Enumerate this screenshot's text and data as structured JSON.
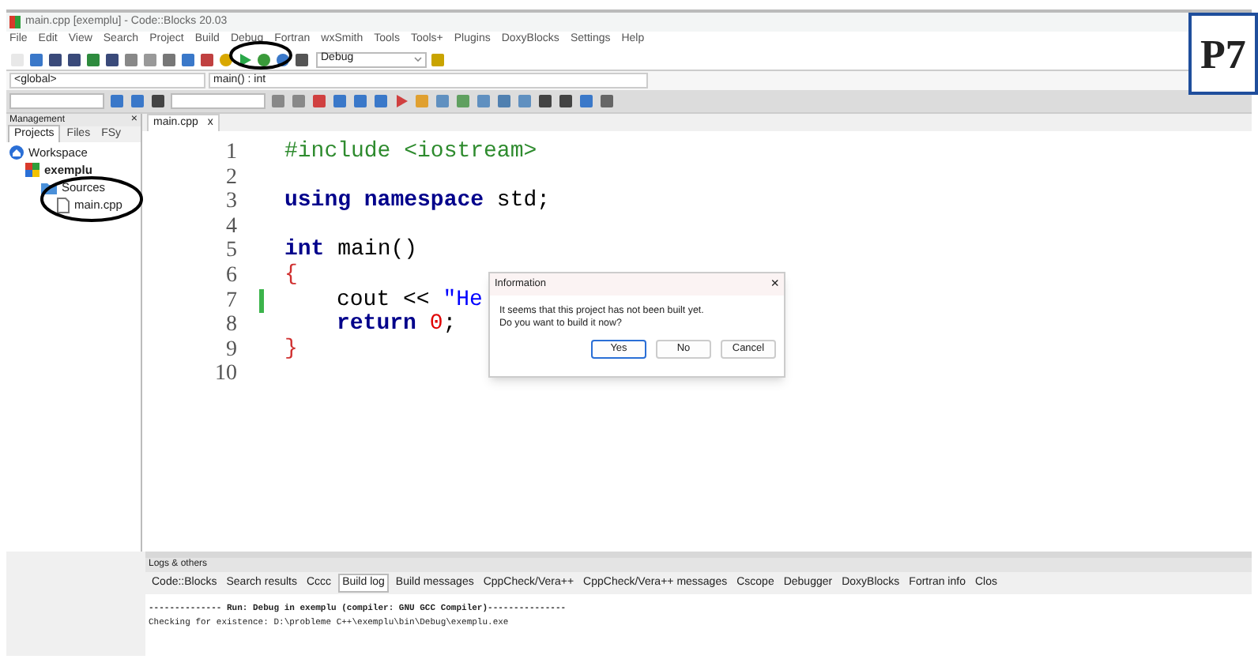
{
  "badge": "P7",
  "window": {
    "title": "main.cpp [exemplu] - Code::Blocks 20.03"
  },
  "menu": [
    "File",
    "Edit",
    "View",
    "Search",
    "Project",
    "Build",
    "Debug",
    "Fortran",
    "wxSmith",
    "Tools",
    "Tools+",
    "Plugins",
    "DoxyBlocks",
    "Settings",
    "Help"
  ],
  "build_target": "Debug",
  "scope_combo": "<global>",
  "function_combo": "main() : int",
  "management": {
    "title": "Management",
    "close": "×",
    "tabs": [
      {
        "label": "Projects",
        "selected": true
      },
      {
        "label": "Files",
        "selected": false
      },
      {
        "label": "FSy",
        "selected": false
      }
    ],
    "tree": [
      {
        "label": "Workspace",
        "kind": "workspace",
        "children": [
          {
            "label": "exemplu",
            "kind": "project",
            "children": [
              {
                "label": "Sources",
                "kind": "folder",
                "children": [
                  {
                    "label": "main.cpp",
                    "kind": "file"
                  }
                ]
              }
            ]
          }
        ]
      }
    ]
  },
  "editor": {
    "tab": "main.cpp",
    "tab_close": "x",
    "lines": [
      {
        "number": "1",
        "changed": false,
        "indented": false,
        "tokens": [
          {
            "kind": "preproc",
            "text": "#include <iostream>"
          }
        ]
      },
      {
        "number": "2",
        "changed": false
      },
      {
        "number": "3",
        "changed": false,
        "indented": false,
        "tokens": [
          {
            "kind": "keyword",
            "text": "using namespace "
          },
          {
            "kind": "plain",
            "text": "std;"
          }
        ]
      },
      {
        "number": "4",
        "changed": false
      },
      {
        "number": "5",
        "changed": false,
        "indented": false,
        "tokens": [
          {
            "kind": "keyword",
            "text": "int "
          },
          {
            "kind": "plain",
            "text": "main()"
          }
        ]
      },
      {
        "number": "6",
        "changed": false,
        "indented": false,
        "tokens": [
          {
            "kind": "brace",
            "text": "{"
          }
        ]
      },
      {
        "number": "7",
        "changed": true,
        "indented": true,
        "tokens": [
          {
            "kind": "plain",
            "text": "cout << "
          },
          {
            "kind": "string",
            "text": "\"He"
          }
        ]
      },
      {
        "number": "8",
        "changed": false,
        "indented": true,
        "tokens": [
          {
            "kind": "keyword",
            "text": "return "
          },
          {
            "kind": "number",
            "text": "0"
          },
          {
            "kind": "plain",
            "text": ";"
          }
        ]
      },
      {
        "number": "9",
        "changed": false,
        "indented": false,
        "tokens": [
          {
            "kind": "brace",
            "text": "}"
          }
        ]
      },
      {
        "number": "10",
        "changed": false
      }
    ]
  },
  "dialog": {
    "title": "Information",
    "close": "×",
    "message": [
      "It seems that this project has not been built yet.",
      "Do you want to build it now?"
    ],
    "buttons": [
      {
        "label": "Yes",
        "selected": true
      },
      {
        "label": "No",
        "selected": false
      },
      {
        "label": "Cancel",
        "selected": false
      }
    ]
  },
  "logs": {
    "title": "Logs & others",
    "tabs": [
      {
        "label": "Code::Blocks",
        "selected": false
      },
      {
        "label": "Search results",
        "selected": false
      },
      {
        "label": "Cccc",
        "selected": false
      },
      {
        "label": "Build log",
        "selected": true
      },
      {
        "label": "Build messages",
        "selected": false
      },
      {
        "label": "CppCheck/Vera++",
        "selected": false
      },
      {
        "label": "CppCheck/Vera++ messages",
        "selected": false
      },
      {
        "label": "Cscope",
        "selected": false
      },
      {
        "label": "Debugger",
        "selected": false
      },
      {
        "label": "DoxyBlocks",
        "selected": false
      },
      {
        "label": "Fortran info",
        "selected": false
      },
      {
        "label": "Clos",
        "selected": false
      }
    ],
    "output": [
      "-------------- Run: Debug in exemplu (compiler: GNU GCC Compiler)---------------",
      "Checking for existence: D:\\probleme C++\\exemplu\\bin\\Debug\\exemplu.exe"
    ]
  }
}
